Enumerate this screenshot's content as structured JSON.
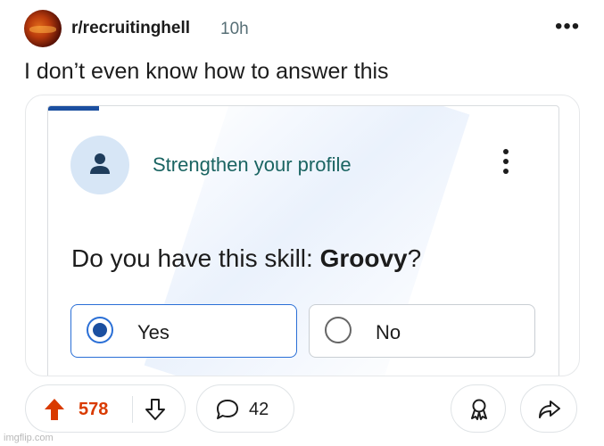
{
  "post": {
    "subreddit": "r/recruitinghell",
    "time": "10h",
    "title": "I don’t even know how to answer this"
  },
  "embedded": {
    "heading": "Strengthen your profile",
    "question_prefix": "Do you have this skill: ",
    "skill": "Groovy",
    "question_suffix": "?",
    "options": [
      {
        "label": "Yes",
        "selected": true
      },
      {
        "label": "No",
        "selected": false
      }
    ]
  },
  "actions": {
    "upvotes": "578",
    "comments": "42"
  },
  "watermark": "imgflip.com",
  "colors": {
    "upvote": "#d93a00",
    "accent_blue": "#1b4fa0",
    "teal_heading": "#1a6462"
  }
}
